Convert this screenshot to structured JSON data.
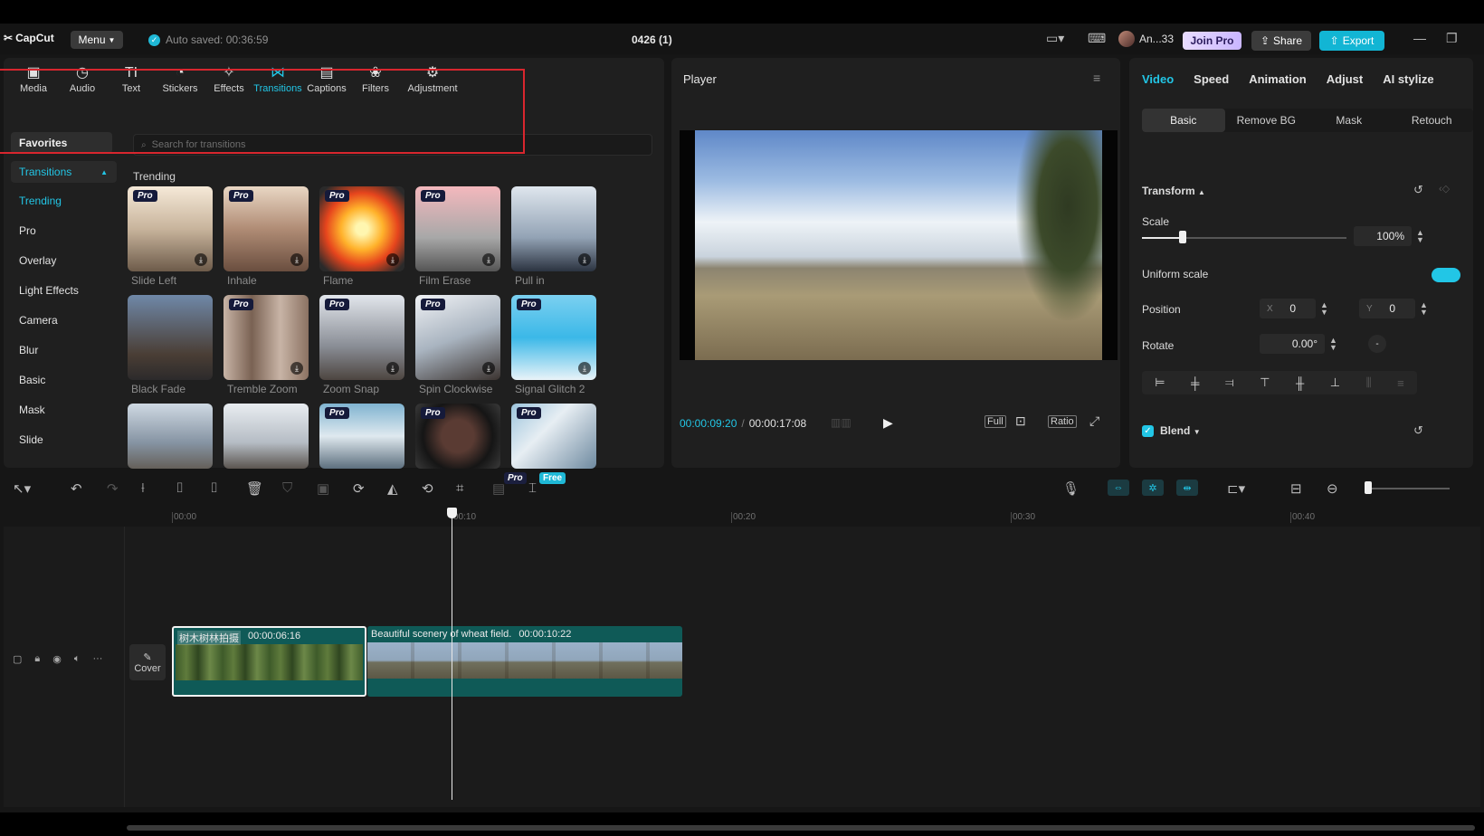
{
  "titlebar": {
    "app_name": "CapCut",
    "menu_label": "Menu",
    "autosave_text": "Auto saved: 00:36:59",
    "project_title": "0426 (1)",
    "user_name": "An...33",
    "join_pro_label": "Join Pro",
    "share_label": "Share",
    "export_label": "Export"
  },
  "toolbar": {
    "tools": [
      {
        "label": "Media",
        "icon": "media-icon"
      },
      {
        "label": "Audio",
        "icon": "audio-icon"
      },
      {
        "label": "Text",
        "icon": "text-icon"
      },
      {
        "label": "Stickers",
        "icon": "stickers-icon"
      },
      {
        "label": "Effects",
        "icon": "effects-icon"
      },
      {
        "label": "Transitions",
        "icon": "transitions-icon",
        "active": true
      },
      {
        "label": "Captions",
        "icon": "captions-icon"
      },
      {
        "label": "Filters",
        "icon": "filters-icon"
      },
      {
        "label": "Adjustment",
        "icon": "adjustment-icon"
      }
    ]
  },
  "sidebar": {
    "favorites": "Favorites",
    "transitions": "Transitions",
    "items": [
      "Trending",
      "Pro",
      "Overlay",
      "Light Effects",
      "Camera",
      "Blur",
      "Basic",
      "Mask",
      "Slide"
    ]
  },
  "search": {
    "placeholder": "Search for transitions"
  },
  "section_title": "Trending",
  "transitions_grid": [
    {
      "label": "Slide Left",
      "pro": "Pro"
    },
    {
      "label": "Inhale",
      "pro": "Pro"
    },
    {
      "label": "Flame",
      "pro": "Pro"
    },
    {
      "label": "Film Erase",
      "pro": "Pro"
    },
    {
      "label": "Pull in",
      "pro": ""
    },
    {
      "label": "Black Fade",
      "pro": ""
    },
    {
      "label": "Tremble Zoom",
      "pro": "Pro"
    },
    {
      "label": "Zoom Snap",
      "pro": "Pro"
    },
    {
      "label": "Spin Clockwise",
      "pro": "Pro"
    },
    {
      "label": "Signal Glitch 2",
      "pro": "Pro"
    },
    {
      "label": "",
      "pro": ""
    },
    {
      "label": "",
      "pro": ""
    },
    {
      "label": "",
      "pro": "Pro"
    },
    {
      "label": "",
      "pro": "Pro"
    },
    {
      "label": "",
      "pro": "Pro"
    }
  ],
  "player": {
    "title": "Player",
    "current_time": "00:00:09:20",
    "separator": "/",
    "total_time": "00:00:17:08",
    "full_label": "Full",
    "ratio_label": "Ratio"
  },
  "properties": {
    "tabs": [
      "Video",
      "Speed",
      "Animation",
      "Adjust",
      "AI stylize"
    ],
    "subtabs": [
      "Basic",
      "Remove BG",
      "Mask",
      "Retouch"
    ],
    "transform_label": "Transform",
    "scale_label": "Scale",
    "scale_value": "100%",
    "scale_fraction": 0.2,
    "uniform_scale_label": "Uniform scale",
    "position_label": "Position",
    "position_x_axis": "X",
    "position_x": "0",
    "position_y_axis": "Y",
    "position_y": "0",
    "rotate_label": "Rotate",
    "rotate_value": "0.00°",
    "blend_label": "Blend"
  },
  "timeline_toolbar": {
    "pro_badge": "Pro",
    "free_badge": "Free"
  },
  "ruler": [
    "00:00",
    "00:10",
    "00:20",
    "00:30",
    "00:40"
  ],
  "timeline": {
    "cover_label": "Cover",
    "clip1": {
      "tag": "树木树林拍摄",
      "duration": "00:00:06:16"
    },
    "clip2": {
      "title": "Beautiful scenery of wheat field.",
      "duration": "00:00:10:22"
    }
  },
  "colors": {
    "accent": "#22c6e6",
    "highlight_box": "#d8262e",
    "clip": "#0f5a57"
  }
}
